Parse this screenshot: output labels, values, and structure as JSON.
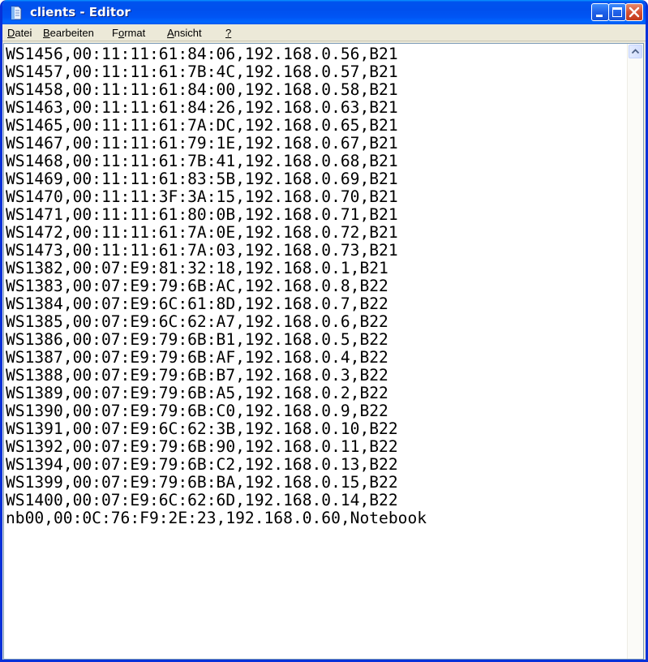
{
  "window": {
    "title": "clients - Editor",
    "icon": "notepad-icon",
    "controls": {
      "minimize": "minimize-icon",
      "maximize": "maximize-icon",
      "close": "close-icon"
    },
    "colors": {
      "titlebar": "#0054e3",
      "close_button": "#d55234",
      "chrome": "#ece9d8"
    }
  },
  "menu": {
    "items": [
      {
        "accel": "D",
        "rest": "atei"
      },
      {
        "accel": "B",
        "rest": "earbeiten"
      },
      {
        "pre": "F",
        "accel": "o",
        "rest": "rmat"
      },
      {
        "accel": "A",
        "rest": "nsicht"
      },
      {
        "accel": "?",
        "rest": ""
      }
    ]
  },
  "editor": {
    "lines": [
      "WS1456,00:11:11:61:84:06,192.168.0.56,B21",
      "WS1457,00:11:11:61:7B:4C,192.168.0.57,B21",
      "WS1458,00:11:11:61:84:00,192.168.0.58,B21",
      "WS1463,00:11:11:61:84:26,192.168.0.63,B21",
      "WS1465,00:11:11:61:7A:DC,192.168.0.65,B21",
      "WS1467,00:11:11:61:79:1E,192.168.0.67,B21",
      "WS1468,00:11:11:61:7B:41,192.168.0.68,B21",
      "WS1469,00:11:11:61:83:5B,192.168.0.69,B21",
      "WS1470,00:11:11:3F:3A:15,192.168.0.70,B21",
      "WS1471,00:11:11:61:80:0B,192.168.0.71,B21",
      "WS1472,00:11:11:61:7A:0E,192.168.0.72,B21",
      "WS1473,00:11:11:61:7A:03,192.168.0.73,B21",
      "WS1382,00:07:E9:81:32:18,192.168.0.1,B21",
      "WS1383,00:07:E9:79:6B:AC,192.168.0.8,B22",
      "WS1384,00:07:E9:6C:61:8D,192.168.0.7,B22",
      "WS1385,00:07:E9:6C:62:A7,192.168.0.6,B22",
      "WS1386,00:07:E9:79:6B:B1,192.168.0.5,B22",
      "WS1387,00:07:E9:79:6B:AF,192.168.0.4,B22",
      "WS1388,00:07:E9:79:6B:B7,192.168.0.3,B22",
      "WS1389,00:07:E9:79:6B:A5,192.168.0.2,B22",
      "WS1390,00:07:E9:79:6B:C0,192.168.0.9,B22",
      "WS1391,00:07:E9:6C:62:3B,192.168.0.10,B22",
      "WS1392,00:07:E9:79:6B:90,192.168.0.11,B22",
      "WS1394,00:07:E9:79:6B:C2,192.168.0.13,B22",
      "WS1399,00:07:E9:79:6B:BA,192.168.0.15,B22",
      "WS1400,00:07:E9:6C:62:6D,192.168.0.14,B22",
      "nb00,00:0C:76:F9:2E:23,192.168.0.60,Notebook"
    ]
  },
  "scrollbar": {
    "up_arrow": "scroll-up-arrow-icon"
  }
}
